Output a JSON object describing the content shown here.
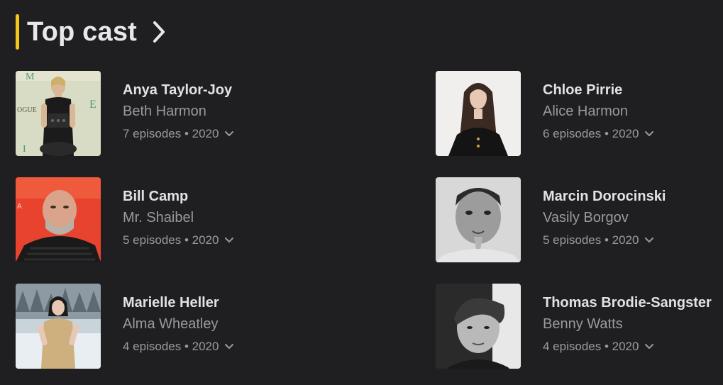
{
  "section": {
    "title": "Top cast",
    "accent_color": "#f5c518",
    "chevron_icon": "chevron-right-icon"
  },
  "cast": [
    {
      "name": "Anya Taylor-Joy",
      "role": "Beth Harmon",
      "episodes": "7 episodes • 2020",
      "photo": "photo-color-event"
    },
    {
      "name": "Chloe Pirrie",
      "role": "Alice Harmon",
      "episodes": "6 episodes • 2020",
      "photo": "photo-color-studio"
    },
    {
      "name": "Bill Camp",
      "role": "Mr. Shaibel",
      "episodes": "5 episodes • 2020",
      "photo": "photo-color-red-backdrop"
    },
    {
      "name": "Marcin Dorocinski",
      "role": "Vasily Borgov",
      "episodes": "5 episodes • 2020",
      "photo": "photo-bw-portrait"
    },
    {
      "name": "Marielle Heller",
      "role": "Alma Wheatley",
      "episodes": "4 episodes • 2020",
      "photo": "photo-color-snow"
    },
    {
      "name": "Thomas Brodie-Sangster",
      "role": "Benny Watts",
      "episodes": "4 episodes • 2020",
      "photo": "photo-bw-portrait"
    }
  ],
  "colors": {
    "background": "#1f1f21",
    "name_text": "#e2e2e2",
    "secondary_text": "#9a9a9a"
  }
}
